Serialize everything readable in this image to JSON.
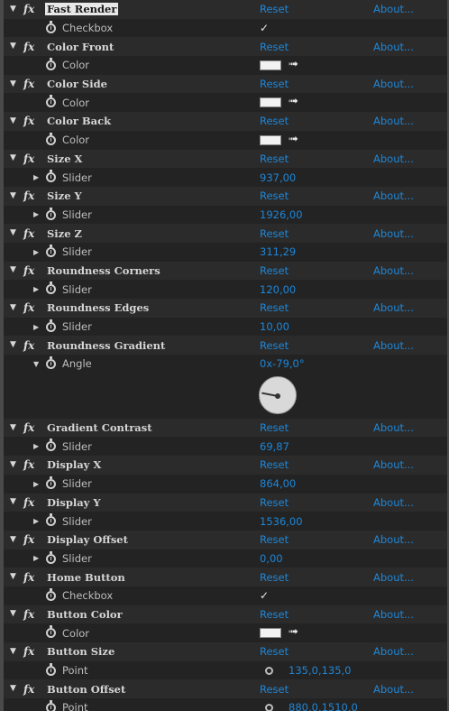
{
  "reset_label": "Reset",
  "about_label": "About...",
  "rows": [
    {
      "kind": "effect",
      "name": "Fast Render",
      "selected": true
    },
    {
      "kind": "param",
      "twirl": false,
      "name": "Checkbox",
      "type": "checkbox",
      "value": "✓"
    },
    {
      "kind": "effect",
      "name": "Color Front"
    },
    {
      "kind": "param",
      "twirl": false,
      "name": "Color",
      "type": "color",
      "value": "#f2f2f2"
    },
    {
      "kind": "effect",
      "name": "Color Side"
    },
    {
      "kind": "param",
      "twirl": false,
      "name": "Color",
      "type": "color",
      "value": "#f2f2f2"
    },
    {
      "kind": "effect",
      "name": "Color Back"
    },
    {
      "kind": "param",
      "twirl": false,
      "name": "Color",
      "type": "color",
      "value": "#f2f2f2"
    },
    {
      "kind": "effect",
      "name": "Size X"
    },
    {
      "kind": "param",
      "twirl": true,
      "name": "Slider",
      "type": "number",
      "value": "937,00"
    },
    {
      "kind": "effect",
      "name": "Size Y"
    },
    {
      "kind": "param",
      "twirl": true,
      "name": "Slider",
      "type": "number",
      "value": "1926,00"
    },
    {
      "kind": "effect",
      "name": "Size Z"
    },
    {
      "kind": "param",
      "twirl": true,
      "name": "Slider",
      "type": "number",
      "value": "311,29"
    },
    {
      "kind": "effect",
      "name": "Roundness Corners"
    },
    {
      "kind": "param",
      "twirl": true,
      "name": "Slider",
      "type": "number",
      "value": "120,00"
    },
    {
      "kind": "effect",
      "name": "Roundness Edges"
    },
    {
      "kind": "param",
      "twirl": true,
      "name": "Slider",
      "type": "number",
      "value": "10,00"
    },
    {
      "kind": "effect",
      "name": "Roundness Gradient"
    },
    {
      "kind": "param",
      "twirl": true,
      "open": true,
      "name": "Angle",
      "type": "number",
      "value": "0x-79,0°"
    },
    {
      "kind": "dial"
    },
    {
      "kind": "effect",
      "name": "Gradient Contrast"
    },
    {
      "kind": "param",
      "twirl": true,
      "name": "Slider",
      "type": "number",
      "value": "69,87"
    },
    {
      "kind": "effect",
      "name": "Display X"
    },
    {
      "kind": "param",
      "twirl": true,
      "name": "Slider",
      "type": "number",
      "value": "864,00"
    },
    {
      "kind": "effect",
      "name": "Display Y"
    },
    {
      "kind": "param",
      "twirl": true,
      "name": "Slider",
      "type": "number",
      "value": "1536,00"
    },
    {
      "kind": "effect",
      "name": "Display Offset"
    },
    {
      "kind": "param",
      "twirl": true,
      "name": "Slider",
      "type": "number",
      "value": "0,00"
    },
    {
      "kind": "effect",
      "name": "Home Button"
    },
    {
      "kind": "param",
      "twirl": false,
      "name": "Checkbox",
      "type": "checkbox",
      "value": "✓"
    },
    {
      "kind": "effect",
      "name": "Button Color"
    },
    {
      "kind": "param",
      "twirl": false,
      "name": "Color",
      "type": "color",
      "value": "#f2f2f2"
    },
    {
      "kind": "effect",
      "name": "Button Size"
    },
    {
      "kind": "param",
      "twirl": false,
      "name": "Point",
      "type": "point",
      "value": "135,0,135,0"
    },
    {
      "kind": "effect",
      "name": "Button Offset"
    },
    {
      "kind": "param",
      "twirl": false,
      "name": "Point",
      "type": "point",
      "value": "880,0,1510,0"
    }
  ],
  "icons": {
    "twirl_open": "▼",
    "twirl_closed": "▶",
    "fx": "fx",
    "eyedropper": "➟"
  },
  "colors": {
    "link": "#1f86d6",
    "panel_bg": "#262626"
  }
}
